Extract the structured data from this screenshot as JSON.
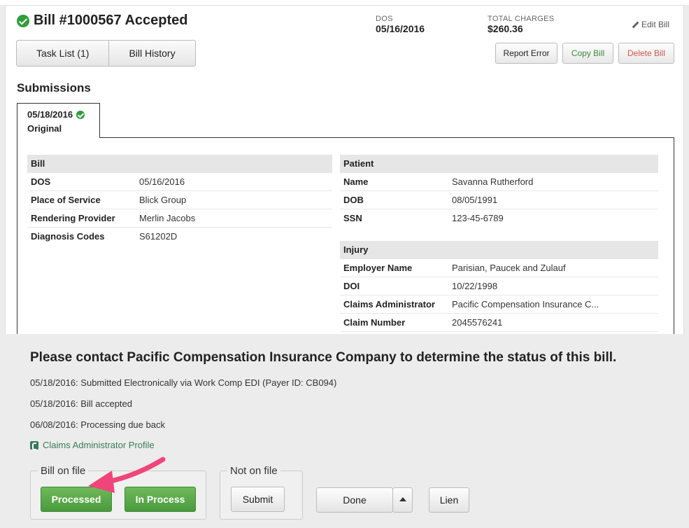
{
  "header": {
    "title": "Bill #1000567 Accepted",
    "dos_label": "DOS",
    "dos_value": "05/16/2016",
    "total_label": "TOTAL CHARGES",
    "total_value": "$260.36",
    "edit_label": "Edit Bill"
  },
  "tabs": {
    "task_list": "Task List (1)",
    "bill_history": "Bill History"
  },
  "actions": {
    "report_error": "Report Error",
    "copy_bill": "Copy Bill",
    "delete_bill": "Delete Bill"
  },
  "submissions": {
    "title": "Submissions",
    "tab_date": "05/18/2016",
    "tab_label": "Original"
  },
  "bill": {
    "header": "Bill",
    "rows": [
      {
        "k": "DOS",
        "v": "05/16/2016"
      },
      {
        "k": "Place of Service",
        "v": "Blick Group"
      },
      {
        "k": "Rendering Provider",
        "v": "Merlin Jacobs"
      },
      {
        "k": "Diagnosis Codes",
        "v": "S61202D"
      }
    ]
  },
  "patient": {
    "header": "Patient",
    "rows": [
      {
        "k": "Name",
        "v": "Savanna Rutherford"
      },
      {
        "k": "DOB",
        "v": "08/05/1991"
      },
      {
        "k": "SSN",
        "v": "123-45-6789"
      }
    ]
  },
  "injury": {
    "header": "Injury",
    "rows": [
      {
        "k": "Employer Name",
        "v": "Parisian, Paucek and Zulauf"
      },
      {
        "k": "DOI",
        "v": "10/22/1998"
      },
      {
        "k": "Claims Administrator",
        "v": "Pacific Compensation Insurance C..."
      },
      {
        "k": "Claim Number",
        "v": "2045576241"
      }
    ]
  },
  "status": {
    "notice": "Please contact Pacific Compensation Insurance Company to determine the status of this bill.",
    "log": [
      "05/18/2016: Submitted Electronically via Work Comp EDI (Payer ID: CB094)",
      "05/18/2016: Bill accepted",
      "06/08/2016: Processing due back"
    ],
    "profile_link": "Claims Administrator Profile"
  },
  "bill_on_file": {
    "legend": "Bill on file",
    "processed": "Processed",
    "in_process": "In Process"
  },
  "not_on_file": {
    "legend": "Not on file",
    "submit": "Submit"
  },
  "done_label": "Done",
  "lien_label": "Lien",
  "colors": {
    "accent_green": "#4a9a3c",
    "arrow_pink": "#f0457a",
    "delete_red": "#d9534f"
  }
}
